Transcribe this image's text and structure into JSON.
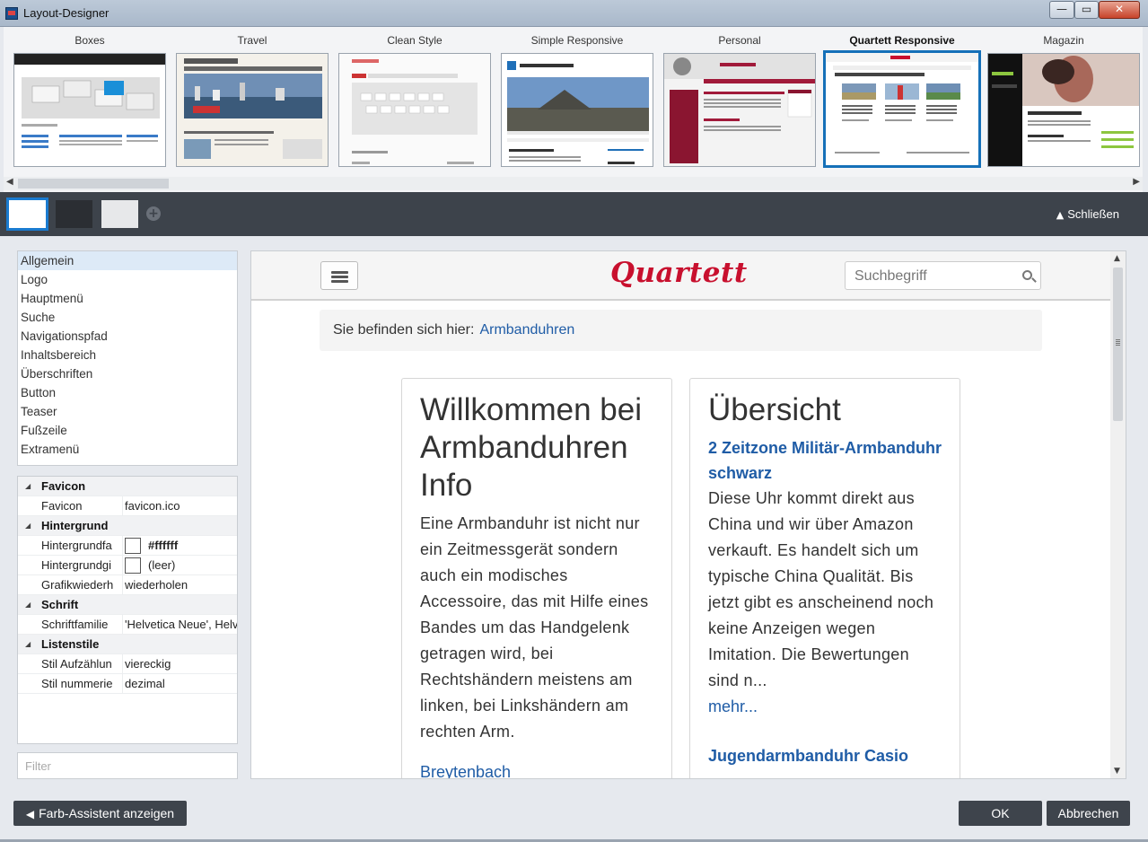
{
  "window": {
    "title": "Layout-Designer",
    "minimize_glyph": "—",
    "maximize_glyph": "▭",
    "close_glyph": "✕"
  },
  "templates": [
    {
      "label": "Boxes"
    },
    {
      "label": "Travel"
    },
    {
      "label": "Clean Style"
    },
    {
      "label": "Simple Responsive"
    },
    {
      "label": "Personal"
    },
    {
      "label": "Quartett Responsive",
      "selected": true
    },
    {
      "label": "Magazin"
    }
  ],
  "toolbar": {
    "collapse_label": "Schließen",
    "collapse_icon": "chevron-up-icon",
    "swatches": [
      "#ffffff",
      "#2b2e33",
      "#e7e8ea"
    ],
    "add_glyph": "+"
  },
  "nav": {
    "items": [
      {
        "label": "Allgemein",
        "active": true
      },
      {
        "label": "Logo"
      },
      {
        "label": "Hauptmenü"
      },
      {
        "label": "Suche"
      },
      {
        "label": "Navigationspfad"
      },
      {
        "label": "Inhaltsbereich"
      },
      {
        "label": "Überschriften"
      },
      {
        "label": "Button"
      },
      {
        "label": "Teaser"
      },
      {
        "label": "Fußzeile"
      },
      {
        "label": "Extramenü"
      }
    ]
  },
  "props": {
    "groups": [
      {
        "name": "Favicon",
        "rows": [
          {
            "name": "Favicon",
            "value": "favicon.ico"
          }
        ]
      },
      {
        "name": "Hintergrund",
        "rows": [
          {
            "name": "Hintergrundfa",
            "value": "#ffffff",
            "swatch": true,
            "bold": true
          },
          {
            "name": "Hintergrundgi",
            "value": "(leer)",
            "swatch": true
          },
          {
            "name": "Grafikwiederh",
            "value": "wiederholen"
          }
        ]
      },
      {
        "name": "Schrift",
        "rows": [
          {
            "name": "Schriftfamilie",
            "value": "'Helvetica Neue', Helv"
          }
        ]
      },
      {
        "name": "Listenstile",
        "rows": [
          {
            "name": "Stil Aufzählun",
            "value": "viereckig"
          },
          {
            "name": "Stil nummerie",
            "value": "dezimal"
          }
        ]
      }
    ],
    "filter_placeholder": "Filter"
  },
  "preview": {
    "logo": "Quartett",
    "search_placeholder": "Suchbegriff",
    "breadcrumb_label": "Sie befinden sich hier:",
    "breadcrumb_link": "Armbanduhren",
    "card1": {
      "title": "Willkommen bei Armbanduhren Info",
      "body": "Eine Armbanduhr ist nicht nur ein Zeitmessgerät sondern auch ein modisches Accessoire, das mit Hilfe eines Bandes um das Handgelenk getragen wird, bei Rechtshändern meistens am linken, bei Linkshändern am rechten Arm.",
      "link": "Breytenbach"
    },
    "card2": {
      "title": "Übersicht",
      "item1_title": "2 Zeitzone Militär-Armbanduhr schwarz",
      "item1_body": "Diese Uhr kommt direkt aus China und wir über Amazon verkauft. Es handelt sich um typische China Qualität. Bis jetzt gibt es anscheinend noch keine Anzeigen wegen Imitation. Die Bewertungen sind n...",
      "item1_more": "mehr...",
      "item2_title": "Jugendarmbanduhr Casio"
    }
  },
  "bottom": {
    "assistant_label": "Farb-Assistent anzeigen",
    "ok_label": "OK",
    "cancel_label": "Abbrechen"
  },
  "colors": {
    "accent": "#1570b8",
    "logo_red": "#c8102e",
    "link_blue": "#1f5ca6",
    "dark_bar": "#3d434b"
  }
}
